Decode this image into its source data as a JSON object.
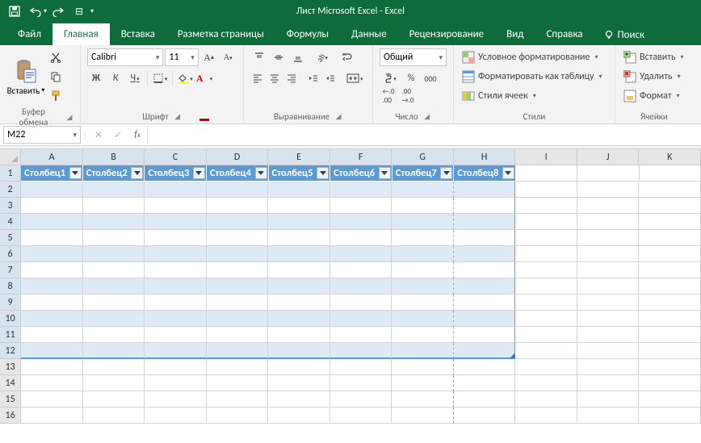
{
  "title": "Лист Microsoft Excel  -  Excel",
  "qat": {
    "save": "save",
    "undo": "undo",
    "redo": "redo",
    "touch": "touch-mode",
    "customize": "customize-qat"
  },
  "tabs": {
    "file": "Файл",
    "home": "Главная",
    "insert": "Вставка",
    "pagelayout": "Разметка страницы",
    "formulas": "Формулы",
    "data": "Данные",
    "review": "Рецензирование",
    "view": "Вид",
    "help": "Справка",
    "search": "Поиск"
  },
  "ribbon": {
    "clipboard": {
      "paste": "Вставить",
      "label": "Буфер обмена"
    },
    "font": {
      "name": "Calibri",
      "size": "11",
      "bold": "Ж",
      "italic": "К",
      "underline": "Ч",
      "label": "Шрифт"
    },
    "align": {
      "label": "Выравнивание"
    },
    "number": {
      "format": "Общий",
      "label": "Число"
    },
    "styles": {
      "cond": "Условное форматирование",
      "fmtTable": "Форматировать как таблицу",
      "cellStyles": "Стили ячеек",
      "label": "Стили"
    },
    "cells": {
      "insert": "Вставить",
      "delete": "Удалить",
      "format": "Формат",
      "label": "Ячейки"
    }
  },
  "nameBox": "M22",
  "formula": "",
  "columns": [
    "A",
    "B",
    "C",
    "D",
    "E",
    "F",
    "G",
    "H",
    "I",
    "J",
    "K"
  ],
  "rows": [
    "1",
    "2",
    "3",
    "4",
    "5",
    "6",
    "7",
    "8",
    "9",
    "10",
    "11",
    "12",
    "13",
    "14",
    "15",
    "16"
  ],
  "table": {
    "lastCol": 8,
    "lastRow": 12,
    "headers": [
      "Столбец1",
      "Столбец2",
      "Столбец3",
      "Столбец4",
      "Столбец5",
      "Столбец6",
      "Столбец7",
      "Столбец8"
    ]
  }
}
